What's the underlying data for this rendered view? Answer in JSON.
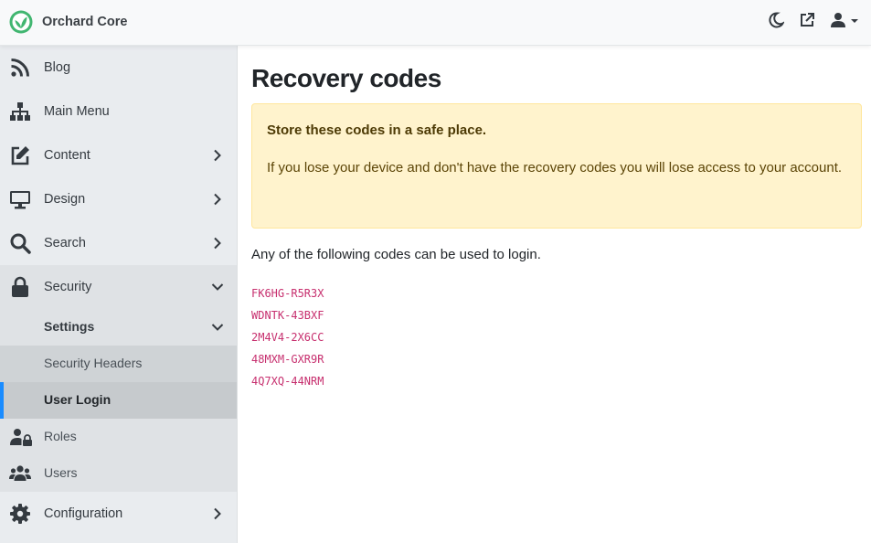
{
  "app": {
    "title": "Orchard Core"
  },
  "header": {
    "theme_toggle_icon": "moon-icon",
    "visit_site_icon": "external-link-icon",
    "user_menu_icon": "user-icon"
  },
  "sidebar": {
    "items": [
      {
        "label": "Blog",
        "icon": "rss-icon"
      },
      {
        "label": "Main Menu",
        "icon": "sitemap-icon"
      },
      {
        "label": "Content",
        "icon": "edit-icon"
      },
      {
        "label": "Design",
        "icon": "monitor-icon"
      },
      {
        "label": "Search",
        "icon": "search-icon"
      },
      {
        "label": "Security",
        "icon": "lock-icon"
      },
      {
        "label": "Configuration",
        "icon": "gear-icon"
      }
    ],
    "security": {
      "settings_label": "Settings",
      "settings_children": [
        {
          "label": "Security Headers"
        },
        {
          "label": "User Login"
        }
      ],
      "roles_label": "Roles",
      "users_label": "Users"
    }
  },
  "main": {
    "title": "Recovery codes",
    "alert": {
      "heading": "Store these codes in a safe place.",
      "body": "If you lose your device and don't have the recovery codes you will lose access to your account."
    },
    "intro": "Any of the following codes can be used to login.",
    "codes": [
      "FK6HG-R5R3X",
      "WDNTK-43BXF",
      "2M4V4-2X6CC",
      "48MXM-GXR9R",
      "4Q7XQ-44NRM"
    ]
  },
  "colors": {
    "accent": "#1a8cff",
    "brand_green": "#41b670",
    "alert_bg": "#fff3cd",
    "code_text": "#c7306f"
  }
}
